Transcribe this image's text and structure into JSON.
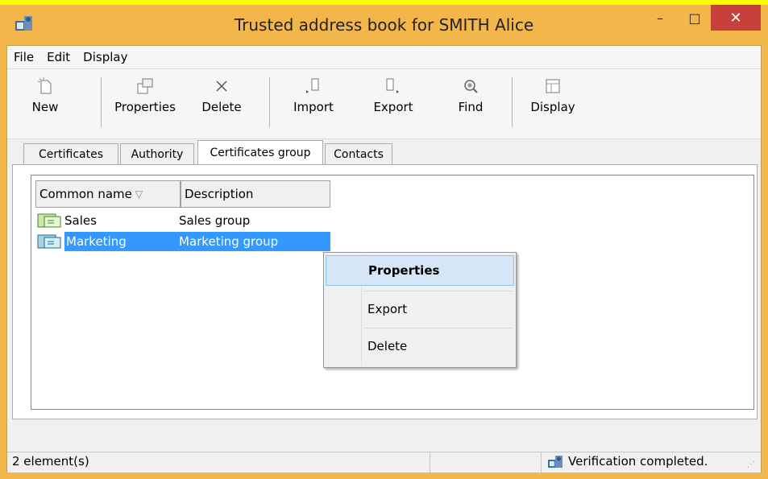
{
  "window": {
    "title": "Trusted address book for SMITH Alice"
  },
  "window_controls": {
    "minimize": "–",
    "maximize": "□",
    "close": "✕"
  },
  "menu": [
    "File",
    "Edit",
    "Display"
  ],
  "toolbar": [
    {
      "label": "New",
      "icon": "new-icon"
    },
    {
      "label": "Properties",
      "icon": "properties-icon"
    },
    {
      "label": "Delete",
      "icon": "delete-icon"
    },
    {
      "label": "Import",
      "icon": "import-icon"
    },
    {
      "label": "Export",
      "icon": "export-icon"
    },
    {
      "label": "Find",
      "icon": "find-icon"
    },
    {
      "label": "Display",
      "icon": "display-icon"
    }
  ],
  "tabs": [
    "Certificates",
    "Authority",
    "Certificates group",
    "Contacts"
  ],
  "active_tab": "Certificates group",
  "list": {
    "columns": [
      "Common name",
      "Description"
    ],
    "sort_indicator": "▽",
    "rows": [
      {
        "name": "Sales",
        "description": "Sales group",
        "selected": false
      },
      {
        "name": "Marketing",
        "description": "Marketing group",
        "selected": true
      }
    ]
  },
  "context_menu": [
    "Properties",
    "Export",
    "Delete"
  ],
  "status": {
    "count": "2 element(s)",
    "message": "Verification completed."
  },
  "colors": {
    "titlebar": "#f3b64a",
    "close": "#c7403a",
    "selection": "#3399ff",
    "menu_highlight": "#d5e6f7"
  }
}
